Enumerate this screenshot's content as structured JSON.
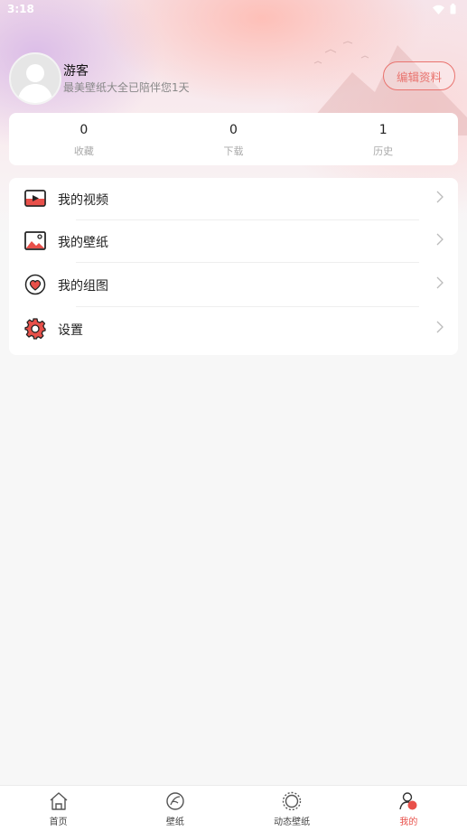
{
  "status": {
    "time": "3:18"
  },
  "profile": {
    "name": "游客",
    "tagline": "最美壁纸大全已陪伴您1天",
    "edit_label": "编辑资料"
  },
  "stats": [
    {
      "value": "0",
      "label": "收藏"
    },
    {
      "value": "0",
      "label": "下载"
    },
    {
      "value": "1",
      "label": "历史"
    }
  ],
  "menu": [
    {
      "label": "我的视频",
      "icon": "video-icon"
    },
    {
      "label": "我的壁纸",
      "icon": "image-icon"
    },
    {
      "label": "我的组图",
      "icon": "heart-album-icon"
    },
    {
      "label": "设置",
      "icon": "gear-icon"
    }
  ],
  "tabs": [
    {
      "label": "首页",
      "icon": "home-icon"
    },
    {
      "label": "壁纸",
      "icon": "wallpaper-icon"
    },
    {
      "label": "动态壁纸",
      "icon": "live-wallpaper-icon"
    },
    {
      "label": "我的",
      "icon": "user-icon",
      "active": true
    }
  ],
  "colors": {
    "accent": "#e8504a",
    "edit_button": "#e9736e"
  }
}
